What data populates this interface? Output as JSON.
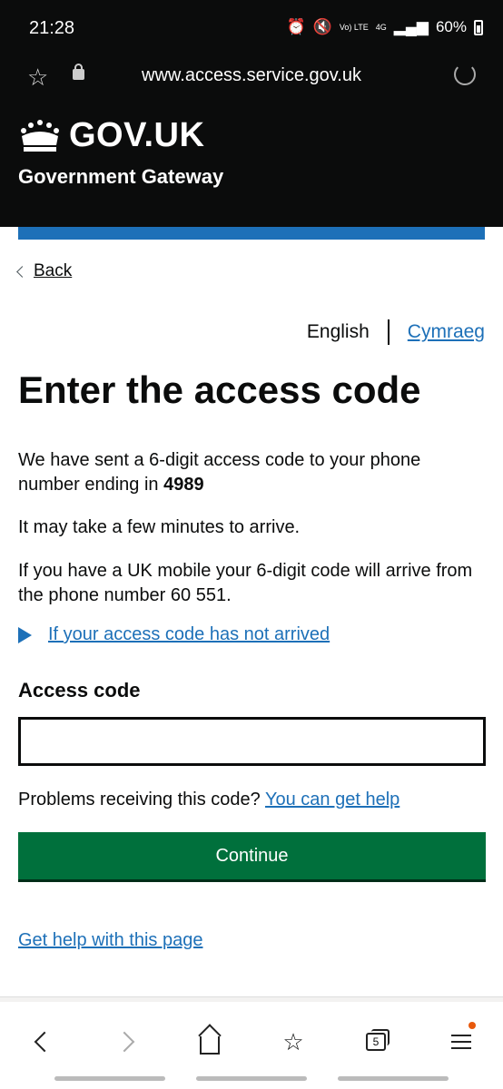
{
  "status_bar": {
    "time": "21:28",
    "signal_label": "Vo) LTE",
    "network": "4G",
    "battery": "60%"
  },
  "browser": {
    "url": "www.access.service.gov.uk"
  },
  "header": {
    "logo_text": "GOV.UK",
    "service_name": "Government Gateway"
  },
  "page": {
    "back_label": "Back",
    "lang_english": "English",
    "lang_welsh": "Cymraeg",
    "title": "Enter the access code",
    "para1_prefix": "We have sent a 6-digit access code to your phone number ending in ",
    "para1_digits": "4989",
    "para2": "It may take a few minutes to arrive.",
    "para3": "If you have a UK mobile your 6-digit code will arrive from the phone number 60 551.",
    "details_summary": "If your access code has not arrived",
    "field_label": "Access code",
    "field_value": "",
    "problems_prefix": "Problems receiving this code?",
    "problems_link": "You can get help",
    "continue_label": "Continue",
    "help_page_link": "Get help with this page"
  },
  "bottom_nav": {
    "tab_count": "5"
  },
  "colors": {
    "link": "#1d70b8",
    "button": "#00703c",
    "header_bg": "#0b0c0c"
  }
}
